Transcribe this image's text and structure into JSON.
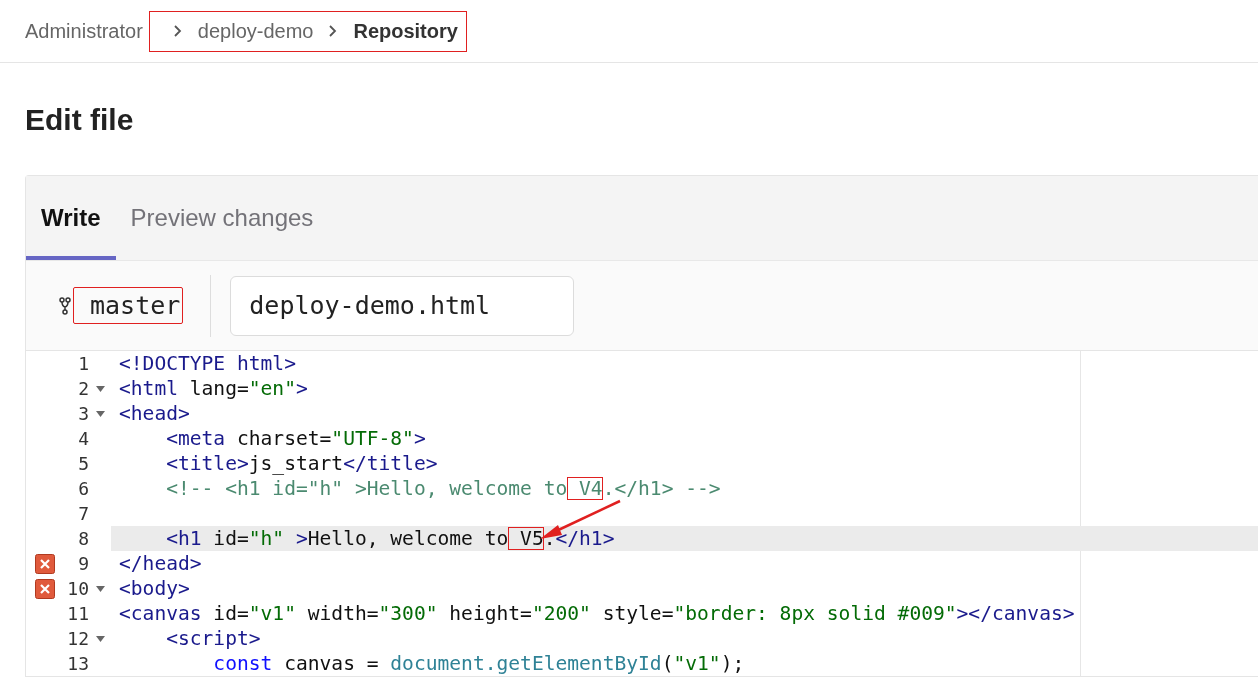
{
  "breadcrumb": [
    {
      "label": "Administrator",
      "current": false
    },
    {
      "label": "deploy-demo",
      "current": false,
      "marked": true
    },
    {
      "label": "Repository",
      "current": true,
      "marked": true
    }
  ],
  "page_title": "Edit file",
  "tabs": [
    {
      "label": "Write",
      "selected": true
    },
    {
      "label": "Preview changes",
      "selected": false
    }
  ],
  "branch": {
    "name": "master",
    "marked": true
  },
  "file_name": {
    "value": "deploy-demo.html"
  },
  "editor": {
    "lines": [
      {
        "number": "1",
        "fold": false,
        "error": false,
        "highlighted": false,
        "tokens": [
          {
            "kind": "tag",
            "text": "<!DOCTYPE html>"
          }
        ]
      },
      {
        "number": "2",
        "fold": true,
        "error": false,
        "highlighted": false,
        "tokens": [
          {
            "kind": "tag",
            "text": "<html"
          },
          {
            "kind": "attr",
            "text": " lang="
          },
          {
            "kind": "string",
            "text": "\"en\""
          },
          {
            "kind": "tag",
            "text": ">"
          }
        ]
      },
      {
        "number": "3",
        "fold": true,
        "error": false,
        "highlighted": false,
        "tokens": [
          {
            "kind": "tag",
            "text": "<head>"
          }
        ]
      },
      {
        "number": "4",
        "fold": false,
        "error": false,
        "highlighted": false,
        "tokens": [
          {
            "kind": "tag",
            "text": "    <meta"
          },
          {
            "kind": "attr",
            "text": " charset="
          },
          {
            "kind": "string",
            "text": "\"UTF-8\""
          },
          {
            "kind": "tag",
            "text": ">"
          }
        ]
      },
      {
        "number": "5",
        "fold": false,
        "error": false,
        "highlighted": false,
        "tokens": [
          {
            "kind": "tag",
            "text": "    <title>"
          },
          {
            "kind": "text",
            "text": "js_start"
          },
          {
            "kind": "tag",
            "text": "</title>"
          }
        ]
      },
      {
        "number": "6",
        "fold": false,
        "error": false,
        "highlighted": false,
        "tokens": [
          {
            "kind": "comment",
            "text": "    <!-- <h1 id=\"h\" >Hello, welcome to"
          },
          {
            "kind": "comment",
            "text": " V4",
            "marked": true
          },
          {
            "kind": "comment",
            "text": ".</h1> -->"
          }
        ]
      },
      {
        "number": "7",
        "fold": false,
        "error": false,
        "highlighted": false
      },
      {
        "number": "8",
        "fold": false,
        "error": false,
        "highlighted": true,
        "tokens": [
          {
            "kind": "tag",
            "text": "    <h1"
          },
          {
            "kind": "attr",
            "text": " id="
          },
          {
            "kind": "string",
            "text": "\"h\""
          },
          {
            "kind": "tag",
            "text": " >"
          },
          {
            "kind": "text",
            "text": "Hello, welcome to"
          },
          {
            "kind": "text",
            "text": " V5",
            "marked": true
          },
          {
            "kind": "text",
            "text": "."
          },
          {
            "kind": "tag",
            "text": "</h1>"
          }
        ]
      },
      {
        "number": "9",
        "fold": false,
        "error": true,
        "highlighted": false,
        "tokens": [
          {
            "kind": "tag",
            "text": "</head>"
          }
        ]
      },
      {
        "number": "10",
        "fold": true,
        "error": true,
        "highlighted": false,
        "tokens": [
          {
            "kind": "tag",
            "text": "<body>"
          }
        ]
      },
      {
        "number": "11",
        "fold": false,
        "error": false,
        "highlighted": false,
        "tokens": [
          {
            "kind": "tag",
            "text": "<canvas"
          },
          {
            "kind": "attr",
            "text": " id="
          },
          {
            "kind": "string",
            "text": "\"v1\""
          },
          {
            "kind": "attr",
            "text": " width="
          },
          {
            "kind": "string",
            "text": "\"300\""
          },
          {
            "kind": "attr",
            "text": " height="
          },
          {
            "kind": "string",
            "text": "\"200\""
          },
          {
            "kind": "attr",
            "text": " style="
          },
          {
            "kind": "string",
            "text": "\"border: 8px solid #009\""
          },
          {
            "kind": "tag",
            "text": "></canvas>"
          }
        ]
      },
      {
        "number": "12",
        "fold": true,
        "error": false,
        "highlighted": false,
        "tokens": [
          {
            "kind": "tag",
            "text": "    <script>"
          }
        ]
      },
      {
        "number": "13",
        "fold": false,
        "error": false,
        "highlighted": false,
        "tokens": [
          {
            "kind": "keyword",
            "text": "        const"
          },
          {
            "kind": "text",
            "text": " canvas = "
          },
          {
            "kind": "support",
            "text": "document.getElementById"
          },
          {
            "kind": "text",
            "text": "("
          },
          {
            "kind": "string",
            "text": "\"v1\""
          },
          {
            "kind": "text",
            "text": ");"
          }
        ]
      }
    ]
  }
}
